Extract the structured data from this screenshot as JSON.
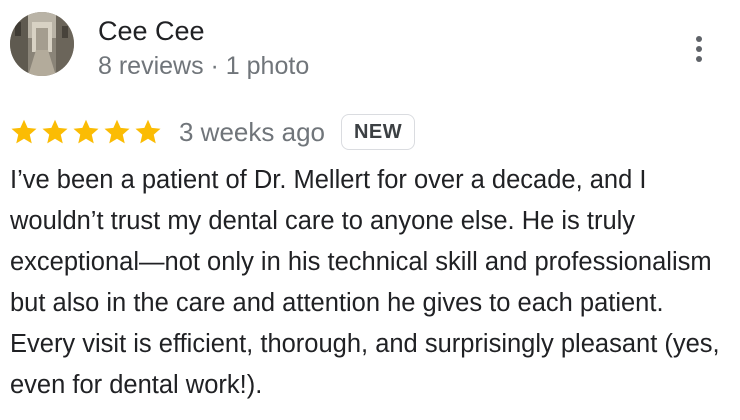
{
  "reviewer": {
    "name": "Cee Cee",
    "meta": "8 reviews · 1 photo",
    "avatar_icon": "reviewer-photo-avatar"
  },
  "actions": {
    "more_icon": "more-vertical-icon"
  },
  "review": {
    "rating": 5,
    "rating_max": 5,
    "star_color": "#fbbc04",
    "date": "3 weeks ago",
    "badge": "NEW",
    "text": "I’ve been a patient of Dr. Mellert for over a decade, and I wouldn’t trust my dental care to anyone else. He is truly exceptional—not only in his technical skill and professionalism but also in the care and attention he gives to each patient. Every visit is efficient, thorough, and surprisingly pleasant (yes, even for dental work!)."
  }
}
